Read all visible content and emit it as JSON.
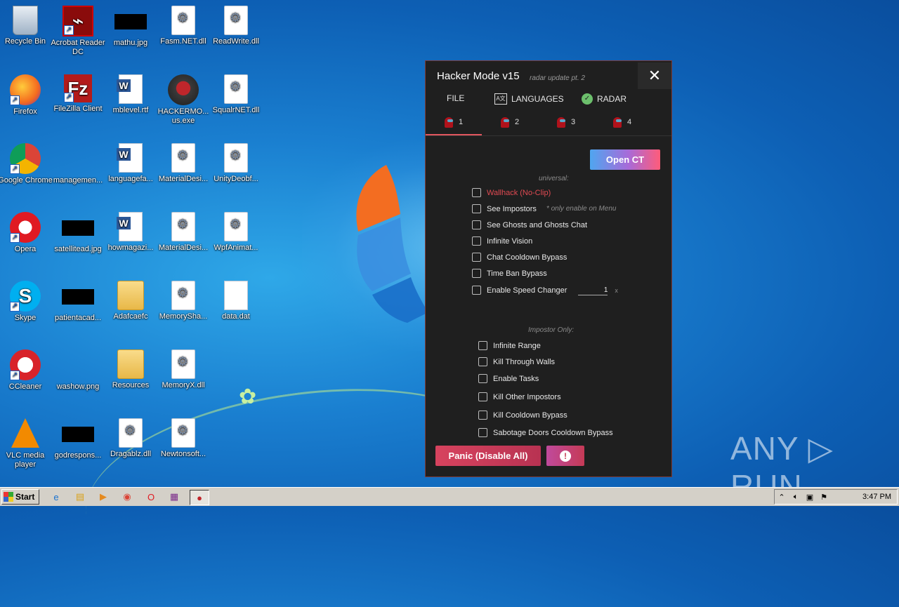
{
  "desktop": {
    "icons": [
      {
        "label": "Recycle Bin",
        "icon": "recycle-bin-icon"
      },
      {
        "label": "Acrobat Reader DC",
        "icon": "acrobat-icon"
      },
      {
        "label": "mathu.jpg",
        "icon": "image-file-icon"
      },
      {
        "label": "Fasm.NET.dll",
        "icon": "dll-file-icon"
      },
      {
        "label": "ReadWrite.dll",
        "icon": "dll-file-icon"
      },
      {
        "label": "Firefox",
        "icon": "firefox-icon"
      },
      {
        "label": "FileZilla Client",
        "icon": "filezilla-icon"
      },
      {
        "label": "mblevel.rtf",
        "icon": "word-doc-icon"
      },
      {
        "label": "HACKERMO... us.exe",
        "icon": "exe-icon"
      },
      {
        "label": "SqualrNET.dll",
        "icon": "dll-file-icon"
      },
      {
        "label": "Google Chrome",
        "icon": "chrome-icon"
      },
      {
        "label": "managemen...",
        "icon": "image-file-icon"
      },
      {
        "label": "languagefa...",
        "icon": "word-doc-icon"
      },
      {
        "label": "MaterialDesi...",
        "icon": "dll-file-icon"
      },
      {
        "label": "UnityDeobf...",
        "icon": "dll-file-icon"
      },
      {
        "label": "Opera",
        "icon": "opera-icon"
      },
      {
        "label": "satellitead.jpg",
        "icon": "image-file-icon"
      },
      {
        "label": "howmagazi...",
        "icon": "word-doc-icon"
      },
      {
        "label": "MaterialDesi...",
        "icon": "dll-file-icon"
      },
      {
        "label": "WpfAnimat...",
        "icon": "dll-file-icon"
      },
      {
        "label": "Skype",
        "icon": "skype-icon"
      },
      {
        "label": "patientacad...",
        "icon": "image-file-icon"
      },
      {
        "label": "Adafcaefc",
        "icon": "folder-icon"
      },
      {
        "label": "MemorySha...",
        "icon": "dll-file-icon"
      },
      {
        "label": "data.dat",
        "icon": "blank-file-icon"
      },
      {
        "label": "CCleaner",
        "icon": "ccleaner-icon"
      },
      {
        "label": "washow.png",
        "icon": "image-file-icon"
      },
      {
        "label": "Resources",
        "icon": "folder-icon"
      },
      {
        "label": "MemoryX.dll",
        "icon": "dll-file-icon"
      },
      {
        "label": "VLC media player",
        "icon": "vlc-icon"
      },
      {
        "label": "godrespons...",
        "icon": "image-file-icon"
      },
      {
        "label": "Dragablz.dll",
        "icon": "dll-file-icon"
      },
      {
        "label": "Newtonsoft...",
        "icon": "dll-file-icon"
      }
    ]
  },
  "app": {
    "title": "Hacker Mode v15",
    "subtitle": "radar update pt. 2",
    "close_glyph": "✕",
    "menu": [
      {
        "label": "FILE"
      },
      {
        "label": "LANGUAGES",
        "icon_text": "A文"
      },
      {
        "label": "RADAR",
        "icon_text": "✓"
      }
    ],
    "tabs": [
      {
        "label": "1",
        "active": true
      },
      {
        "label": "2"
      },
      {
        "label": "3"
      },
      {
        "label": "4"
      }
    ],
    "open_ct_label": "Open CT",
    "universal_heading": "universal:",
    "universal_options": [
      {
        "label": "Wallhack (No-Clip)",
        "checked": false,
        "highlight": true
      },
      {
        "label": "See Impostors",
        "checked": false,
        "hint": "* only enable on Menu"
      },
      {
        "label": "See Ghosts and Ghosts Chat",
        "checked": false
      },
      {
        "label": "Infinite Vision",
        "checked": false
      },
      {
        "label": "Chat Cooldown Bypass",
        "checked": false
      },
      {
        "label": "Time Ban Bypass",
        "checked": false
      },
      {
        "label": "Enable Speed Changer",
        "checked": false,
        "value": "1",
        "unit": "x"
      }
    ],
    "impostor_heading": "Impostor Only:",
    "impostor_options": [
      {
        "label": "Infinite Range",
        "checked": false
      },
      {
        "label": "Kill Through Walls",
        "checked": false
      },
      {
        "label": "Enable Tasks",
        "checked": false
      },
      {
        "label": "Kill Other Impostors",
        "checked": false
      },
      {
        "label": "Kill Cooldown Bypass",
        "checked": false
      },
      {
        "label": "Sabotage Doors Cooldown Bypass",
        "checked": false
      }
    ],
    "panic_label": "Panic (Disable All)",
    "alert_glyph": "!"
  },
  "watermark": "ANY ▷ RUN",
  "taskbar": {
    "start_label": "Start",
    "clock": "3:47 PM",
    "pinned": [
      "ie-icon",
      "explorer-icon",
      "media-player-icon",
      "chrome-icon",
      "opera-icon",
      "winrar-icon",
      "hackermode-icon"
    ]
  }
}
